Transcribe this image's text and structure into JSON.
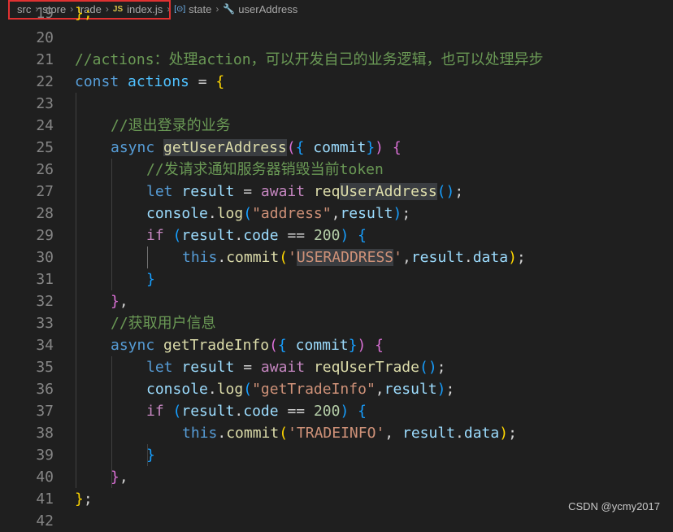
{
  "breadcrumb": {
    "segments": [
      "src",
      "store",
      "trade",
      "index.js",
      "state",
      "userAddress"
    ],
    "js_badge": "JS",
    "symbol_icon": "[⊙]",
    "highlight_color": "#e03131"
  },
  "code": {
    "line_numbers": [
      "20",
      "21",
      "22",
      "23",
      "24",
      "25",
      "26",
      "27",
      "28",
      "29",
      "30",
      "31",
      "32",
      "33",
      "34",
      "35",
      "36",
      "37",
      "38",
      "39",
      "40",
      "41",
      "42"
    ],
    "l19_partial": "19",
    "l19_text": "};",
    "l21": "//actions：处理action，可以开发自己的业务逻辑，也可以处理异步",
    "l22_kw": "const",
    "l22_name": "actions",
    "l22_eq": " = ",
    "l22_brace": "{",
    "l24": "//退出登录的业务",
    "l25_async": "async",
    "l25_fn": "getUserAddress",
    "l25_paren_open": "(",
    "l25_brace_open": "{ ",
    "l25_param": "commit",
    "l25_brace_close": "}",
    "l25_paren_close": ")",
    "l25_block": "{",
    "l26": "//发请求通知服务器销毁当前token",
    "l27_let": "let",
    "l27_var": "result",
    "l27_eq": " = ",
    "l27_await": "await",
    "l27_req": "req",
    "l27_fn": "UserAddress",
    "l27_call": "()",
    "l27_end": ";",
    "l28_obj": "console",
    "l28_dot": ".",
    "l28_fn": "log",
    "l28_open": "(",
    "l28_str": "\"address\"",
    "l28_comma": ",",
    "l28_var": "result",
    "l28_close": ")",
    "l28_end": ";",
    "l29_if": "if",
    "l29_open": "(",
    "l29_var": "result",
    "l29_dot": ".",
    "l29_prop": "code",
    "l29_op": " == ",
    "l29_num": "200",
    "l29_close": ")",
    "l29_block": "{",
    "l30_this": "this",
    "l30_dot": ".",
    "l30_fn": "commit",
    "l30_open": "(",
    "l30_q1": "'",
    "l30_str": "USERADDRESS",
    "l30_q2": "'",
    "l30_comma": ",",
    "l30_var": "result",
    "l30_dot2": ".",
    "l30_prop": "data",
    "l30_close": ")",
    "l30_end": ";",
    "l31": "}",
    "l32_brace": "}",
    "l32_comma": ",",
    "l33": "//获取用户信息",
    "l34_async": "async",
    "l34_fn": "getTradeInfo",
    "l34_paren_open": "(",
    "l34_brace_open": "{ ",
    "l34_param": "commit",
    "l34_brace_close": "}",
    "l34_paren_close": ")",
    "l34_block": "{",
    "l35_let": "let",
    "l35_var": "result",
    "l35_eq": " = ",
    "l35_await": "await",
    "l35_fn": "reqUserTrade",
    "l35_call": "()",
    "l35_end": ";",
    "l36_obj": "console",
    "l36_dot": ".",
    "l36_fn": "log",
    "l36_open": "(",
    "l36_str": "\"getTradeInfo\"",
    "l36_comma": ",",
    "l36_var": "result",
    "l36_close": ")",
    "l36_end": ";",
    "l37_if": "if",
    "l37_open": "(",
    "l37_var": "result",
    "l37_dot": ".",
    "l37_prop": "code",
    "l37_op": " == ",
    "l37_num": "200",
    "l37_close": ")",
    "l37_block": "{",
    "l38_this": "this",
    "l38_dot": ".",
    "l38_fn": "commit",
    "l38_open": "(",
    "l38_str": "'TRADEINFO'",
    "l38_comma": ", ",
    "l38_var": "result",
    "l38_dot2": ".",
    "l38_prop": "data",
    "l38_close": ")",
    "l38_end": ";",
    "l39": "}",
    "l40_brace": "}",
    "l40_comma": ",",
    "l41_brace": "}",
    "l41_end": ";"
  },
  "watermark": "CSDN @ycmy2017",
  "colors": {
    "background": "#1f1f1f",
    "keyword_blue": "#569cd6",
    "keyword_purple": "#c586c0",
    "function": "#dcdcaa",
    "variable": "#9cdcfe",
    "string": "#ce9178",
    "comment": "#6a9955",
    "number": "#b5cea8"
  }
}
